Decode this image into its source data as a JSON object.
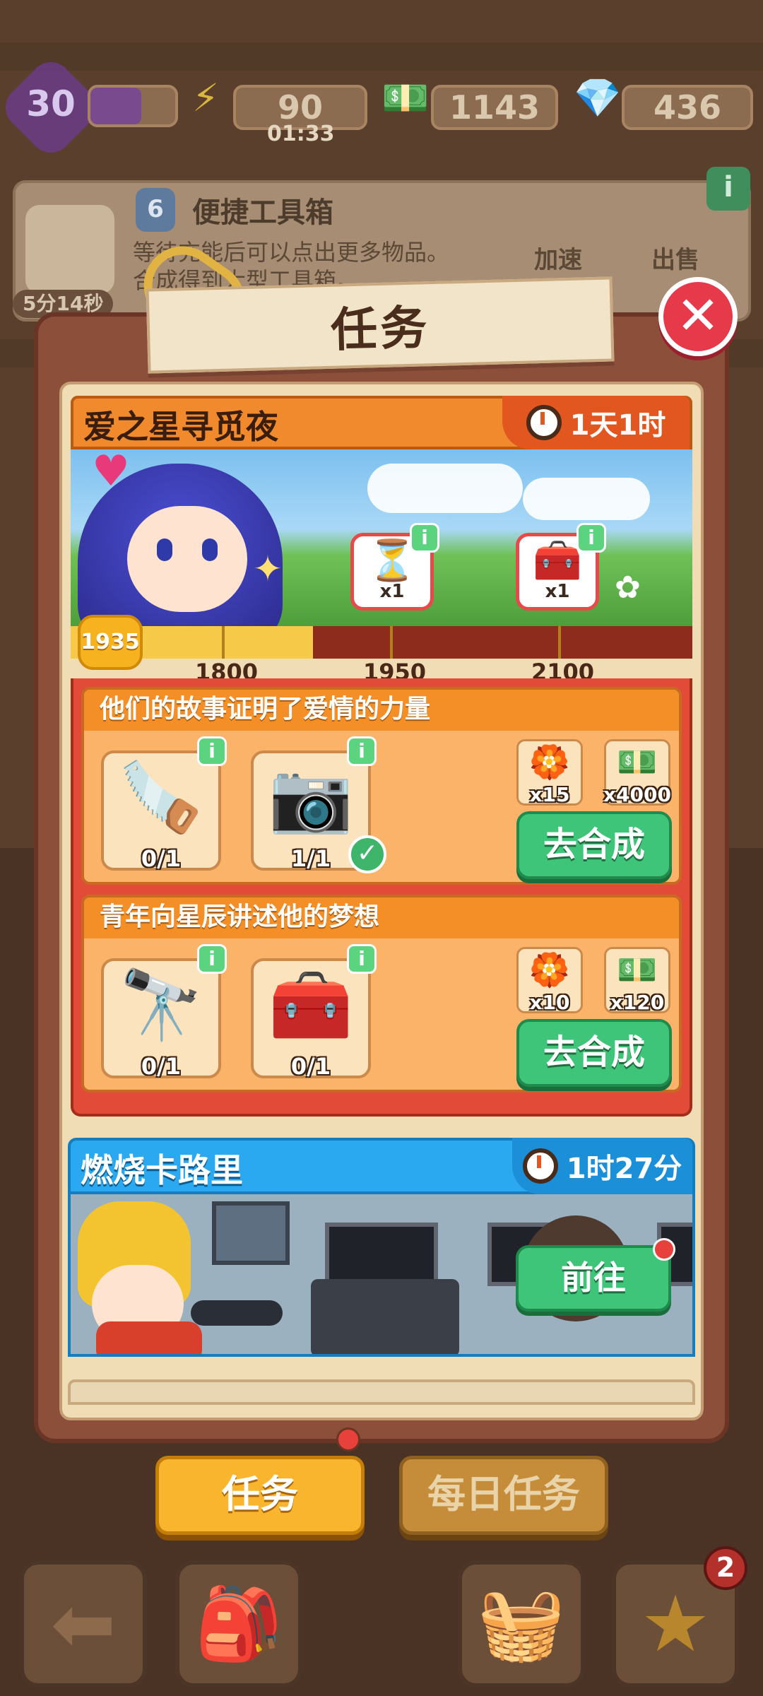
{
  "status_bar": {
    "level": "30",
    "energy": "90",
    "energy_timer": "01:33",
    "cash": "1143",
    "gems": "436"
  },
  "background_panel": {
    "level_badge": "6",
    "title": "便捷工具箱",
    "desc_line1": "等待充能后可以点出更多物品。",
    "desc_line2": "合成得到大型工具箱。",
    "timer": "5分14秒",
    "speedup_label": "加速",
    "sell_label": "出售"
  },
  "modal": {
    "title": "任务",
    "close_icon": "close-icon"
  },
  "event": {
    "title": "爱之星寻觅夜",
    "timer": "1天1时",
    "score": "1935",
    "progress": 0.39,
    "milestones": [
      "1800",
      "1950",
      "2100"
    ],
    "track_rewards": [
      {
        "icon": "hourglass-gem",
        "count": "x1"
      },
      {
        "icon": "treasure-chest",
        "count": "x1"
      }
    ],
    "tasks": [
      {
        "title": "他们的故事证明了爱情的力量",
        "items": [
          {
            "icon": "saw-icon",
            "emoji": "🪚",
            "count": "0/1",
            "done": false
          },
          {
            "icon": "camera-icon",
            "emoji": "📷",
            "count": "1/1",
            "done": true
          }
        ],
        "rewards": [
          {
            "icon": "flower-token-icon",
            "emoji": "🏵️",
            "count": "x15"
          },
          {
            "icon": "cash-icon",
            "emoji": "💵",
            "count": "x4000"
          }
        ],
        "button": "去合成"
      },
      {
        "title": "青年向星辰讲述他的梦想",
        "items": [
          {
            "icon": "binoculars-icon",
            "emoji": "🔭",
            "count": "0/1",
            "done": false
          },
          {
            "icon": "toolbox-icon",
            "emoji": "🧰",
            "count": "0/1",
            "done": false
          }
        ],
        "rewards": [
          {
            "icon": "flower-token-icon",
            "emoji": "🏵️",
            "count": "x10"
          },
          {
            "icon": "cash-icon",
            "emoji": "💵",
            "count": "x120"
          }
        ],
        "button": "去合成"
      }
    ]
  },
  "event2": {
    "title": "燃烧卡路里",
    "timer": "1时27分",
    "button": "前往"
  },
  "tabs": {
    "tasks": "任务",
    "daily": "每日任务"
  },
  "bottom_bar": {
    "star_badge": "2"
  },
  "colors": {
    "accent_orange": "#f08a2c",
    "event_blue": "#2aa8f0",
    "button_green": "#3fc57a",
    "close_red": "#e6394a"
  }
}
